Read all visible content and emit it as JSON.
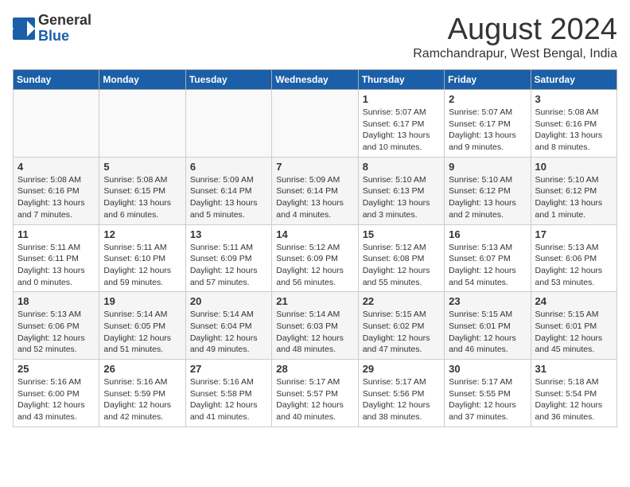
{
  "logo": {
    "general": "General",
    "blue": "Blue"
  },
  "title": {
    "month_year": "August 2024",
    "location": "Ramchandrapur, West Bengal, India"
  },
  "weekdays": [
    "Sunday",
    "Monday",
    "Tuesday",
    "Wednesday",
    "Thursday",
    "Friday",
    "Saturday"
  ],
  "weeks": [
    [
      {
        "day": "",
        "info": ""
      },
      {
        "day": "",
        "info": ""
      },
      {
        "day": "",
        "info": ""
      },
      {
        "day": "",
        "info": ""
      },
      {
        "day": "1",
        "info": "Sunrise: 5:07 AM\nSunset: 6:17 PM\nDaylight: 13 hours\nand 10 minutes."
      },
      {
        "day": "2",
        "info": "Sunrise: 5:07 AM\nSunset: 6:17 PM\nDaylight: 13 hours\nand 9 minutes."
      },
      {
        "day": "3",
        "info": "Sunrise: 5:08 AM\nSunset: 6:16 PM\nDaylight: 13 hours\nand 8 minutes."
      }
    ],
    [
      {
        "day": "4",
        "info": "Sunrise: 5:08 AM\nSunset: 6:16 PM\nDaylight: 13 hours\nand 7 minutes."
      },
      {
        "day": "5",
        "info": "Sunrise: 5:08 AM\nSunset: 6:15 PM\nDaylight: 13 hours\nand 6 minutes."
      },
      {
        "day": "6",
        "info": "Sunrise: 5:09 AM\nSunset: 6:14 PM\nDaylight: 13 hours\nand 5 minutes."
      },
      {
        "day": "7",
        "info": "Sunrise: 5:09 AM\nSunset: 6:14 PM\nDaylight: 13 hours\nand 4 minutes."
      },
      {
        "day": "8",
        "info": "Sunrise: 5:10 AM\nSunset: 6:13 PM\nDaylight: 13 hours\nand 3 minutes."
      },
      {
        "day": "9",
        "info": "Sunrise: 5:10 AM\nSunset: 6:12 PM\nDaylight: 13 hours\nand 2 minutes."
      },
      {
        "day": "10",
        "info": "Sunrise: 5:10 AM\nSunset: 6:12 PM\nDaylight: 13 hours\nand 1 minute."
      }
    ],
    [
      {
        "day": "11",
        "info": "Sunrise: 5:11 AM\nSunset: 6:11 PM\nDaylight: 13 hours\nand 0 minutes."
      },
      {
        "day": "12",
        "info": "Sunrise: 5:11 AM\nSunset: 6:10 PM\nDaylight: 12 hours\nand 59 minutes."
      },
      {
        "day": "13",
        "info": "Sunrise: 5:11 AM\nSunset: 6:09 PM\nDaylight: 12 hours\nand 57 minutes."
      },
      {
        "day": "14",
        "info": "Sunrise: 5:12 AM\nSunset: 6:09 PM\nDaylight: 12 hours\nand 56 minutes."
      },
      {
        "day": "15",
        "info": "Sunrise: 5:12 AM\nSunset: 6:08 PM\nDaylight: 12 hours\nand 55 minutes."
      },
      {
        "day": "16",
        "info": "Sunrise: 5:13 AM\nSunset: 6:07 PM\nDaylight: 12 hours\nand 54 minutes."
      },
      {
        "day": "17",
        "info": "Sunrise: 5:13 AM\nSunset: 6:06 PM\nDaylight: 12 hours\nand 53 minutes."
      }
    ],
    [
      {
        "day": "18",
        "info": "Sunrise: 5:13 AM\nSunset: 6:06 PM\nDaylight: 12 hours\nand 52 minutes."
      },
      {
        "day": "19",
        "info": "Sunrise: 5:14 AM\nSunset: 6:05 PM\nDaylight: 12 hours\nand 51 minutes."
      },
      {
        "day": "20",
        "info": "Sunrise: 5:14 AM\nSunset: 6:04 PM\nDaylight: 12 hours\nand 49 minutes."
      },
      {
        "day": "21",
        "info": "Sunrise: 5:14 AM\nSunset: 6:03 PM\nDaylight: 12 hours\nand 48 minutes."
      },
      {
        "day": "22",
        "info": "Sunrise: 5:15 AM\nSunset: 6:02 PM\nDaylight: 12 hours\nand 47 minutes."
      },
      {
        "day": "23",
        "info": "Sunrise: 5:15 AM\nSunset: 6:01 PM\nDaylight: 12 hours\nand 46 minutes."
      },
      {
        "day": "24",
        "info": "Sunrise: 5:15 AM\nSunset: 6:01 PM\nDaylight: 12 hours\nand 45 minutes."
      }
    ],
    [
      {
        "day": "25",
        "info": "Sunrise: 5:16 AM\nSunset: 6:00 PM\nDaylight: 12 hours\nand 43 minutes."
      },
      {
        "day": "26",
        "info": "Sunrise: 5:16 AM\nSunset: 5:59 PM\nDaylight: 12 hours\nand 42 minutes."
      },
      {
        "day": "27",
        "info": "Sunrise: 5:16 AM\nSunset: 5:58 PM\nDaylight: 12 hours\nand 41 minutes."
      },
      {
        "day": "28",
        "info": "Sunrise: 5:17 AM\nSunset: 5:57 PM\nDaylight: 12 hours\nand 40 minutes."
      },
      {
        "day": "29",
        "info": "Sunrise: 5:17 AM\nSunset: 5:56 PM\nDaylight: 12 hours\nand 38 minutes."
      },
      {
        "day": "30",
        "info": "Sunrise: 5:17 AM\nSunset: 5:55 PM\nDaylight: 12 hours\nand 37 minutes."
      },
      {
        "day": "31",
        "info": "Sunrise: 5:18 AM\nSunset: 5:54 PM\nDaylight: 12 hours\nand 36 minutes."
      }
    ]
  ]
}
